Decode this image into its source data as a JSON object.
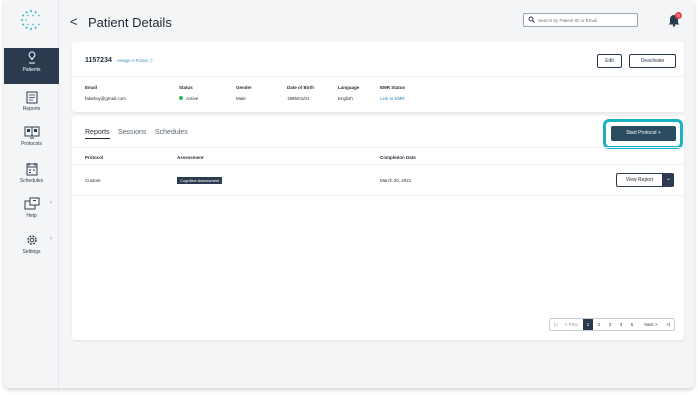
{
  "app": {
    "logo": "brand-dots-logo"
  },
  "sidebar": {
    "items": [
      {
        "label": "Patients",
        "icon": "patient-icon"
      },
      {
        "label": "Reports",
        "icon": "report-icon"
      },
      {
        "label": "Protocols",
        "icon": "protocol-icon"
      },
      {
        "label": "Schedules",
        "icon": "calendar-icon"
      },
      {
        "label": "Help",
        "icon": "help-chat-icon"
      },
      {
        "label": "Settings",
        "icon": "gear-icon"
      }
    ]
  },
  "header": {
    "title": "Patient Details",
    "search_placeholder": "Search by Patient ID or Email",
    "notification_count": "5"
  },
  "patient": {
    "id": "1157234",
    "assign_focus": "Assign A Focus ⓘ",
    "edit_label": "Edit",
    "deactivate_label": "Deactivate",
    "fields": {
      "email_label": "Email",
      "email": "fakeboy@gmail.com",
      "status_label": "Status",
      "status": "Active",
      "gender_label": "Gender",
      "gender": "Male",
      "dob_label": "Date of Birth",
      "dob": "1986/01/01",
      "language_label": "Language",
      "language": "English",
      "emr_label": "EMR Status",
      "emr": "Link to EMR"
    }
  },
  "reports": {
    "tabs": [
      "Reports",
      "Sessions",
      "Schedules"
    ],
    "start_label": "Start Protocol  +",
    "columns": [
      "Protocol",
      "Assessment",
      "Completion Date"
    ],
    "rows": [
      {
        "protocol": "Custom",
        "assessment": "Cognitive Assessment",
        "date": "March 20, 2021",
        "action": "View Report"
      }
    ]
  },
  "pagination": {
    "first": "|<",
    "prev": "< Prev",
    "pages": [
      "1",
      "2",
      "3",
      "4",
      "5"
    ],
    "current": "1",
    "next": "Next >",
    "last": ">|"
  },
  "colors": {
    "accent": "#2b4c5f",
    "highlight": "#1ab0c6",
    "active": "#2fb55a",
    "link": "#2d88b4"
  }
}
